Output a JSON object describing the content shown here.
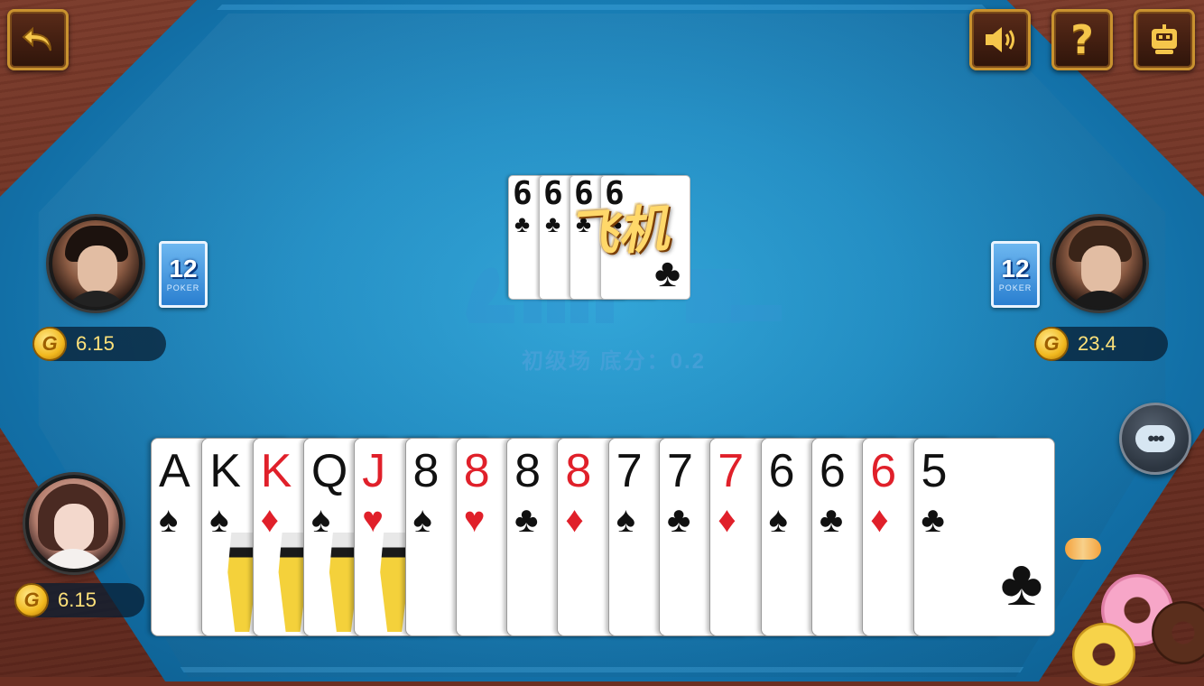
{
  "room": {
    "info": "初级场  底分：0.2"
  },
  "played": {
    "combo_label": "飞机",
    "cards": [
      {
        "rank": "6",
        "suit": "♣",
        "color": "black"
      },
      {
        "rank": "6",
        "suit": "♣",
        "color": "black"
      },
      {
        "rank": "6",
        "suit": "♣",
        "color": "black"
      },
      {
        "rank": "6",
        "suit": "♣",
        "color": "black"
      }
    ]
  },
  "players": {
    "left": {
      "coins": "6.15",
      "cards_left": "12",
      "card_back_label": "POKER"
    },
    "right": {
      "coins": "23.4",
      "cards_left": "12",
      "card_back_label": "POKER"
    },
    "self": {
      "coins": "6.15"
    }
  },
  "hand": [
    {
      "rank": "A",
      "suit": "♠",
      "color": "black"
    },
    {
      "rank": "K",
      "suit": "♠",
      "color": "black"
    },
    {
      "rank": "K",
      "suit": "♦",
      "color": "red"
    },
    {
      "rank": "Q",
      "suit": "♠",
      "color": "black"
    },
    {
      "rank": "J",
      "suit": "♥",
      "color": "red"
    },
    {
      "rank": "8",
      "suit": "♠",
      "color": "black"
    },
    {
      "rank": "8",
      "suit": "♥",
      "color": "red"
    },
    {
      "rank": "8",
      "suit": "♣",
      "color": "black"
    },
    {
      "rank": "8",
      "suit": "♦",
      "color": "red"
    },
    {
      "rank": "7",
      "suit": "♠",
      "color": "black"
    },
    {
      "rank": "7",
      "suit": "♣",
      "color": "black"
    },
    {
      "rank": "7",
      "suit": "♦",
      "color": "red"
    },
    {
      "rank": "6",
      "suit": "♠",
      "color": "black"
    },
    {
      "rank": "6",
      "suit": "♣",
      "color": "black"
    },
    {
      "rank": "6",
      "suit": "♦",
      "color": "red"
    },
    {
      "rank": "5",
      "suit": "♣",
      "color": "black"
    }
  ],
  "icons": {
    "back": "back-arrow-icon",
    "sound": "speaker-icon",
    "help": "question-icon",
    "auto": "robot-icon",
    "chat": "chat-bubble-icon",
    "coin_letter": "G"
  },
  "colors": {
    "felt": "#1f8fc7",
    "wood": "#6b2f22",
    "gold": "#f2c24a",
    "red_suit": "#e0202a"
  }
}
